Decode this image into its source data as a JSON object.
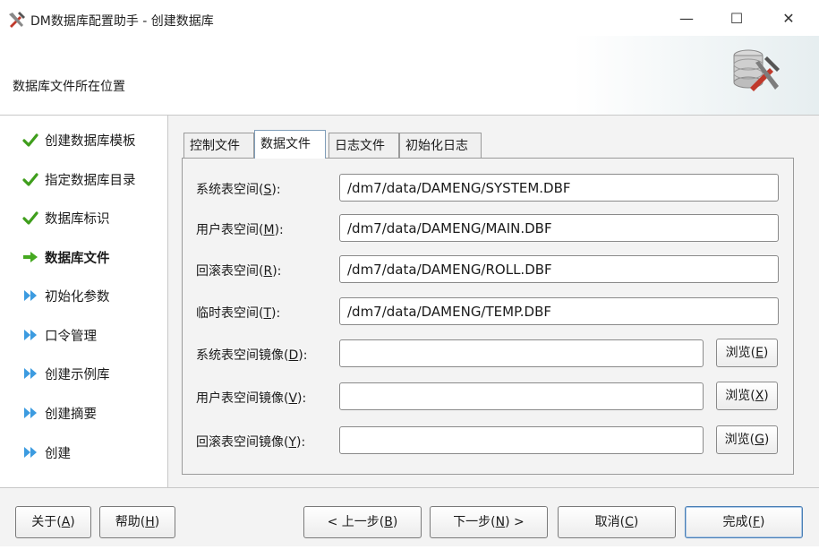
{
  "window": {
    "title": "DM数据库配置助手 - 创建数据库",
    "minimize": "—",
    "maximize": "☐",
    "close": "✕"
  },
  "header": {
    "title": "数据库文件所在位置",
    "icon": "database-tools-icon"
  },
  "sidebar": {
    "steps": [
      {
        "label": "创建数据库模板",
        "state": "done",
        "icon": "check-icon"
      },
      {
        "label": "指定数据库目录",
        "state": "done",
        "icon": "check-icon"
      },
      {
        "label": "数据库标识",
        "state": "done",
        "icon": "check-icon"
      },
      {
        "label": "数据库文件",
        "state": "current",
        "icon": "arrow-right-icon"
      },
      {
        "label": "初始化参数",
        "state": "pending",
        "icon": "double-chevron-icon"
      },
      {
        "label": "口令管理",
        "state": "pending",
        "icon": "double-chevron-icon"
      },
      {
        "label": "创建示例库",
        "state": "pending",
        "icon": "double-chevron-icon"
      },
      {
        "label": "创建摘要",
        "state": "pending",
        "icon": "double-chevron-icon"
      },
      {
        "label": "创建",
        "state": "pending",
        "icon": "double-chevron-icon"
      }
    ]
  },
  "tabs": [
    {
      "label": "控制文件",
      "active": false
    },
    {
      "label": "数据文件",
      "active": true
    },
    {
      "label": "日志文件",
      "active": false
    },
    {
      "label": "初始化日志",
      "active": false
    }
  ],
  "fields": [
    {
      "label": "系统表空间(",
      "key": "S",
      "label_end": "):",
      "value": "/dm7/data/DAMENG/SYSTEM.DBF"
    },
    {
      "label": "用户表空间(",
      "key": "M",
      "label_end": "):",
      "value": "/dm7/data/DAMENG/MAIN.DBF"
    },
    {
      "label": "回滚表空间(",
      "key": "R",
      "label_end": "):",
      "value": "/dm7/data/DAMENG/ROLL.DBF"
    },
    {
      "label": "临时表空间(",
      "key": "T",
      "label_end": "):",
      "value": "/dm7/data/DAMENG/TEMP.DBF"
    },
    {
      "label": "系统表空间镜像(",
      "key": "D",
      "label_end": "):",
      "value": "",
      "browse": "浏览(",
      "browse_key": "E",
      "browse_end": ")"
    },
    {
      "label": "用户表空间镜像(",
      "key": "V",
      "label_end": "):",
      "value": "",
      "browse": "浏览(",
      "browse_key": "X",
      "browse_end": ")"
    },
    {
      "label": "回滚表空间镜像(",
      "key": "Y",
      "label_end": "):",
      "value": "",
      "browse": "浏览(",
      "browse_key": "G",
      "browse_end": ")"
    }
  ],
  "footer": {
    "about": {
      "text": "关于(",
      "key": "A",
      "end": ")"
    },
    "help": {
      "text": "帮助(",
      "key": "H",
      "end": ")"
    },
    "prev": {
      "text": "< 上一步(",
      "key": "B",
      "end": ")"
    },
    "next": {
      "text": "下一步(",
      "key": "N",
      "end": ") >"
    },
    "cancel": {
      "text": "取消(",
      "key": "C",
      "end": ")"
    },
    "finish": {
      "text": "完成(",
      "key": "F",
      "end": ")"
    }
  },
  "colors": {
    "check": "#3f9e1c",
    "arrow": "#45a920",
    "chevron": "#3c9be0",
    "panel": "#f3f3f3",
    "accent_border": "#4a7fb5"
  }
}
